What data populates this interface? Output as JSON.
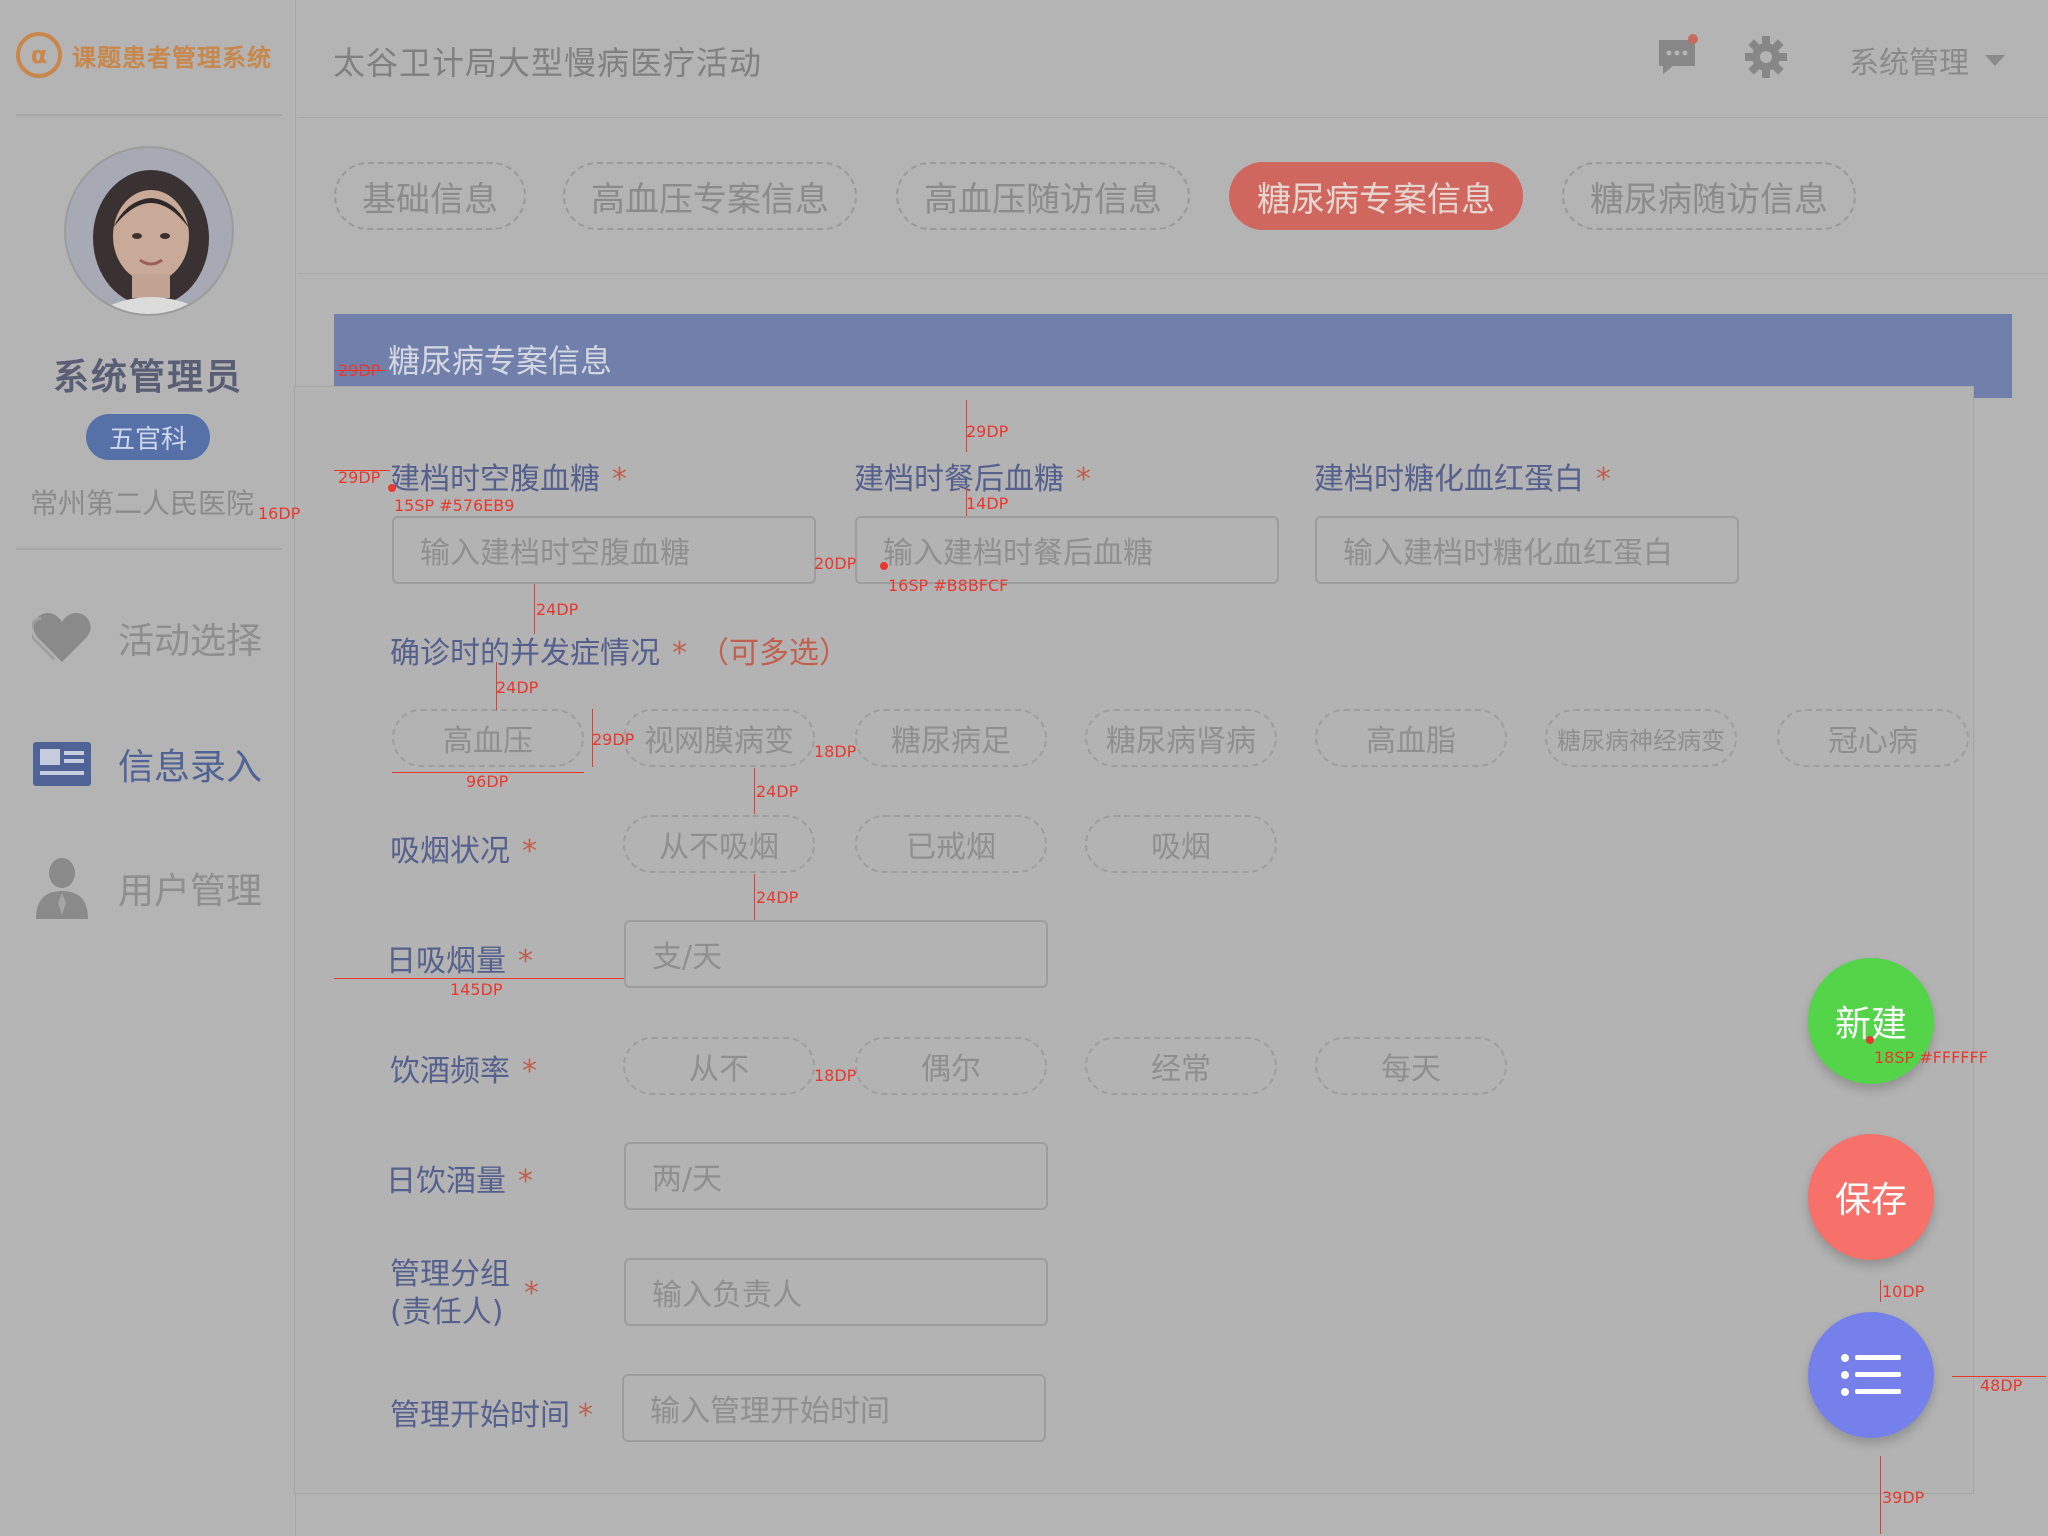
{
  "sidebar": {
    "brand_logo_glyph": "α",
    "brand_name": "课题患者管理系统",
    "user_name": "系统管理员",
    "department": "五官科",
    "hospital": "常州第二人民医院",
    "nav": [
      {
        "label": "活动选择",
        "icon": "heart-icon"
      },
      {
        "label": "信息录入",
        "icon": "id-card-icon"
      },
      {
        "label": "用户管理",
        "icon": "user-icon"
      }
    ]
  },
  "header": {
    "title": "太谷卫计局大型慢病医疗活动",
    "admin_menu": "系统管理"
  },
  "tabs": [
    {
      "label": "基础信息",
      "active": false
    },
    {
      "label": "高血压专案信息",
      "active": false
    },
    {
      "label": "高血压随访信息",
      "active": false
    },
    {
      "label": "糖尿病专案信息",
      "active": true
    },
    {
      "label": "糖尿病随访信息",
      "active": false
    }
  ],
  "section": {
    "title": "糖尿病专案信息"
  },
  "form": {
    "required_mark": "*",
    "fasting_glucose": {
      "label": "建档时空腹血糖",
      "placeholder": "输入建档时空腹血糖"
    },
    "postprandial_glucose": {
      "label": "建档时餐后血糖",
      "placeholder": "输入建档时餐后血糖"
    },
    "hba1c": {
      "label": "建档时糖化血红蛋白",
      "placeholder": "输入建档时糖化血红蛋白"
    },
    "complications": {
      "label": "确诊时的并发症情况",
      "hint": "（可多选）",
      "options": [
        "高血压",
        "视网膜病变",
        "糖尿病足",
        "糖尿病肾病",
        "高血脂",
        "糖尿病神经病变",
        "冠心病"
      ]
    },
    "smoking_status": {
      "label": "吸烟状况",
      "options": [
        "从不吸烟",
        "已戒烟",
        "吸烟"
      ]
    },
    "daily_smoking": {
      "label": "日吸烟量",
      "placeholder": "支/天"
    },
    "drinking_freq": {
      "label": "饮酒频率",
      "options": [
        "从不",
        "偶尔",
        "经常",
        "每天"
      ]
    },
    "daily_drinking": {
      "label": "日饮酒量",
      "placeholder": "两/天"
    },
    "group": {
      "label_line1": "管理分组",
      "label_line2": "(责任人)",
      "placeholder": "输入负责人"
    },
    "start_time": {
      "label": "管理开始时间",
      "placeholder": "输入管理开始时间"
    }
  },
  "fab": {
    "new_label": "新建",
    "save_label": "保存"
  },
  "annotations": {
    "a_29dp_1": "29DP",
    "a_29dp_2": "29DP",
    "a_29dp_3": "29DP",
    "a_29dp_4": "29DP",
    "a_15sp": "15SP #576EB9",
    "a_16dp": "16DP",
    "a_14dp": "14DP",
    "a_20dp": "20DP",
    "a_16sp": "16SP #B8BFCF",
    "a_24dp_1": "24DP",
    "a_24dp_2": "24DP",
    "a_24dp_3": "24DP",
    "a_24dp_4": "24DP",
    "a_18dp_1": "18DP",
    "a_18dp_2": "18DP",
    "a_96dp": "96DP",
    "a_145dp": "145DP",
    "a_18sp": "18SP #FFFFFF",
    "a_10dp": "10DP",
    "a_48dp": "48DP",
    "a_39dp": "39DP"
  },
  "colors": {
    "accent_tab": "#cf675f",
    "section_bar": "#7080aa",
    "fab_new": "#53d449",
    "fab_save": "#f5716a",
    "fab_list": "#7680ea",
    "annotation": "#e8392f"
  }
}
